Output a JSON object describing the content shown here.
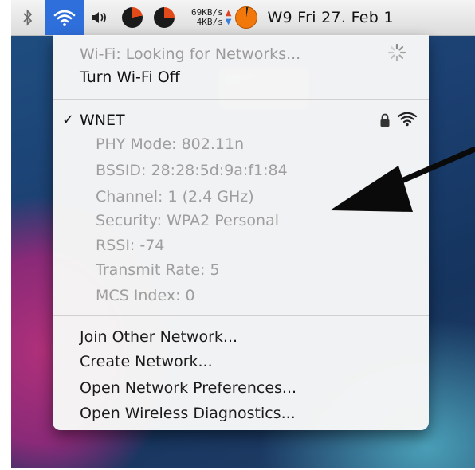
{
  "menubar": {
    "net_rate_up": "69KB/s",
    "net_rate_down": "4KB/s",
    "arrow_up": "▲",
    "arrow_down": "▼",
    "clock": "W9 Fri 27. Feb 1",
    "colors": {
      "wifi_highlight": "#2f6fdb",
      "activity": "#e34a1a"
    }
  },
  "menu": {
    "status": "Wi-Fi: Looking for Networks...",
    "toggle": "Turn Wi-Fi Off",
    "network": {
      "checkmark": "✓",
      "name": "WNET",
      "details": [
        "PHY Mode: 802.11n",
        "BSSID: 28:28:5d:9a:f1:84",
        "Channel: 1 (2.4 GHz)",
        "Security: WPA2 Personal",
        "RSSI: -74",
        "Transmit Rate: 5",
        "MCS Index: 0"
      ]
    },
    "actions": [
      "Join Other Network...",
      "Create Network...",
      "Open Network Preferences...",
      "Open Wireless Diagnostics..."
    ]
  },
  "icons": [
    "bluetooth-icon",
    "wifi-icon",
    "volume-icon",
    "spinner-icon",
    "lock-icon",
    "wifi-signal-icon",
    "arrow-icon"
  ]
}
